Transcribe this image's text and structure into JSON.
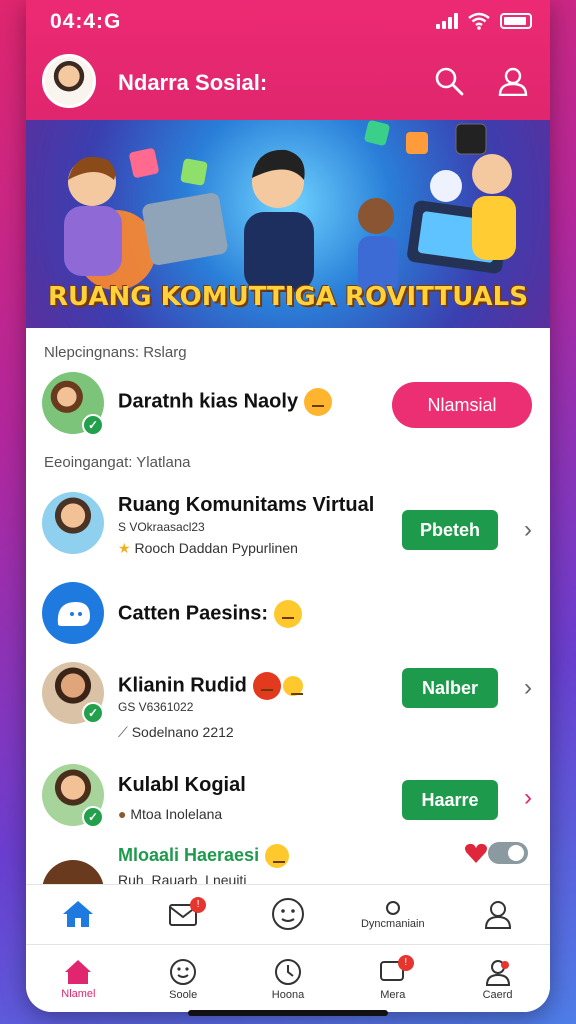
{
  "status_bar": {
    "time": "04:4:G"
  },
  "header": {
    "title": "Ndarra Sosial:"
  },
  "banner": {
    "title": "RUANG KOMUTTIGA ROVITTUALS"
  },
  "sections": {
    "first": "Nlepcingnans: Rslarg",
    "second": "Eeoingangat: Ylatlana"
  },
  "featured": {
    "name": "Daratnh kias Naoly",
    "button": "Nlamsial"
  },
  "list": [
    {
      "name": "Ruang Komunitams Virtual",
      "sub1": "S VOkraasacl23",
      "sub2": "Rooch Daddan Pypurlinen",
      "button": "Pbeteh"
    },
    {
      "name": "Catten Paesins:"
    },
    {
      "name": "Klianin Rudid",
      "sub1": "GS V6361022",
      "sub2": "Sodelnano 2212",
      "button": "Nalber"
    },
    {
      "name": "Kulabl Kogial",
      "sub2": "Mtoa  Inolelana",
      "button": "Haarre"
    },
    {
      "name": "Mloaali Haeraesi"
    }
  ],
  "partial_row": "Ruh_Rauarb_Lneuiti",
  "nav_top": [
    "",
    "",
    "",
    "Dyncmaniain",
    ""
  ],
  "nav_bottom": [
    {
      "label": "Nlamel",
      "active": true
    },
    {
      "label": "Soole",
      "active": false
    },
    {
      "label": "Hoona",
      "active": false
    },
    {
      "label": "Mera",
      "active": false
    },
    {
      "label": "Caerd",
      "active": false
    }
  ],
  "colors": {
    "primary": "#e0266e",
    "green": "#1e9a4c",
    "pill": "#ec2f73"
  }
}
